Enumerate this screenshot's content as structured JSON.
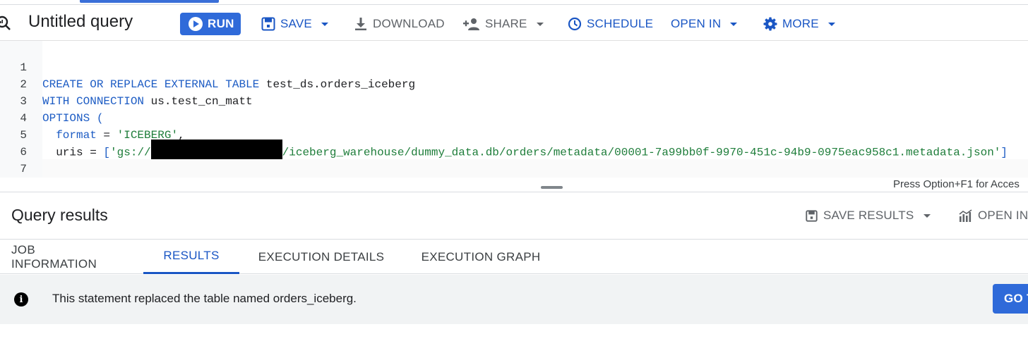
{
  "toolbar": {
    "title": "Untitled query",
    "run_label": "RUN",
    "save_label": "SAVE",
    "download_label": "DOWNLOAD",
    "share_label": "SHARE",
    "schedule_label": "SCHEDULE",
    "open_in_label": "OPEN IN",
    "more_label": "MORE",
    "icons": {
      "query": "query-search-icon",
      "run": "play-circle-icon",
      "save": "save-disk-icon",
      "download": "download-arrow-icon",
      "share": "person-add-icon",
      "schedule": "clock-icon",
      "more": "gear-icon"
    }
  },
  "editor": {
    "line_numbers": [
      "1",
      "2",
      "3",
      "4",
      "5",
      "6",
      "7"
    ],
    "l1_kw": "CREATE OR REPLACE EXTERNAL TABLE",
    "l1_id": " test_ds.orders_iceberg",
    "l2_kw": "WITH CONNECTION",
    "l2_id": " us.test_cn_matt",
    "l3_kw": "OPTIONS (",
    "l4_indent": "  ",
    "l4_kw": "format",
    "l4_op": " = ",
    "l4_str": "'ICEBERG'",
    "l4_comma": ",",
    "l5_indent": "  ",
    "l5_id": "uris = ",
    "l5_bracket": "[",
    "l5_str_start": "'gs://",
    "l5_str_end": "/iceberg_warehouse/dummy_data.db/orders/metadata/00001-7a99bb0f-9970-451c-94b9-0975eac958c1.metadata.json'",
    "l5_bracket_close": "]",
    "l6_kw": ")",
    "l6_semi": ";",
    "access_hint": "Press Option+F1 for Acces"
  },
  "results": {
    "title": "Query results",
    "save_results_label": "SAVE RESULTS",
    "open_in_label": "OPEN IN",
    "tabs": [
      {
        "label": "JOB INFORMATION",
        "active": false
      },
      {
        "label": "RESULTS",
        "active": true
      },
      {
        "label": "EXECUTION DETAILS",
        "active": false
      },
      {
        "label": "EXECUTION GRAPH",
        "active": false
      }
    ],
    "info_message": "This statement replaced the table named orders_iceberg.",
    "goto_label": "GO T"
  },
  "colors": {
    "accent": "#1a56c4",
    "button_blue": "#2f6ad9",
    "keyword": "#1d5cc4",
    "string": "#1e7d3a",
    "info_bg": "#f1f3f4"
  }
}
